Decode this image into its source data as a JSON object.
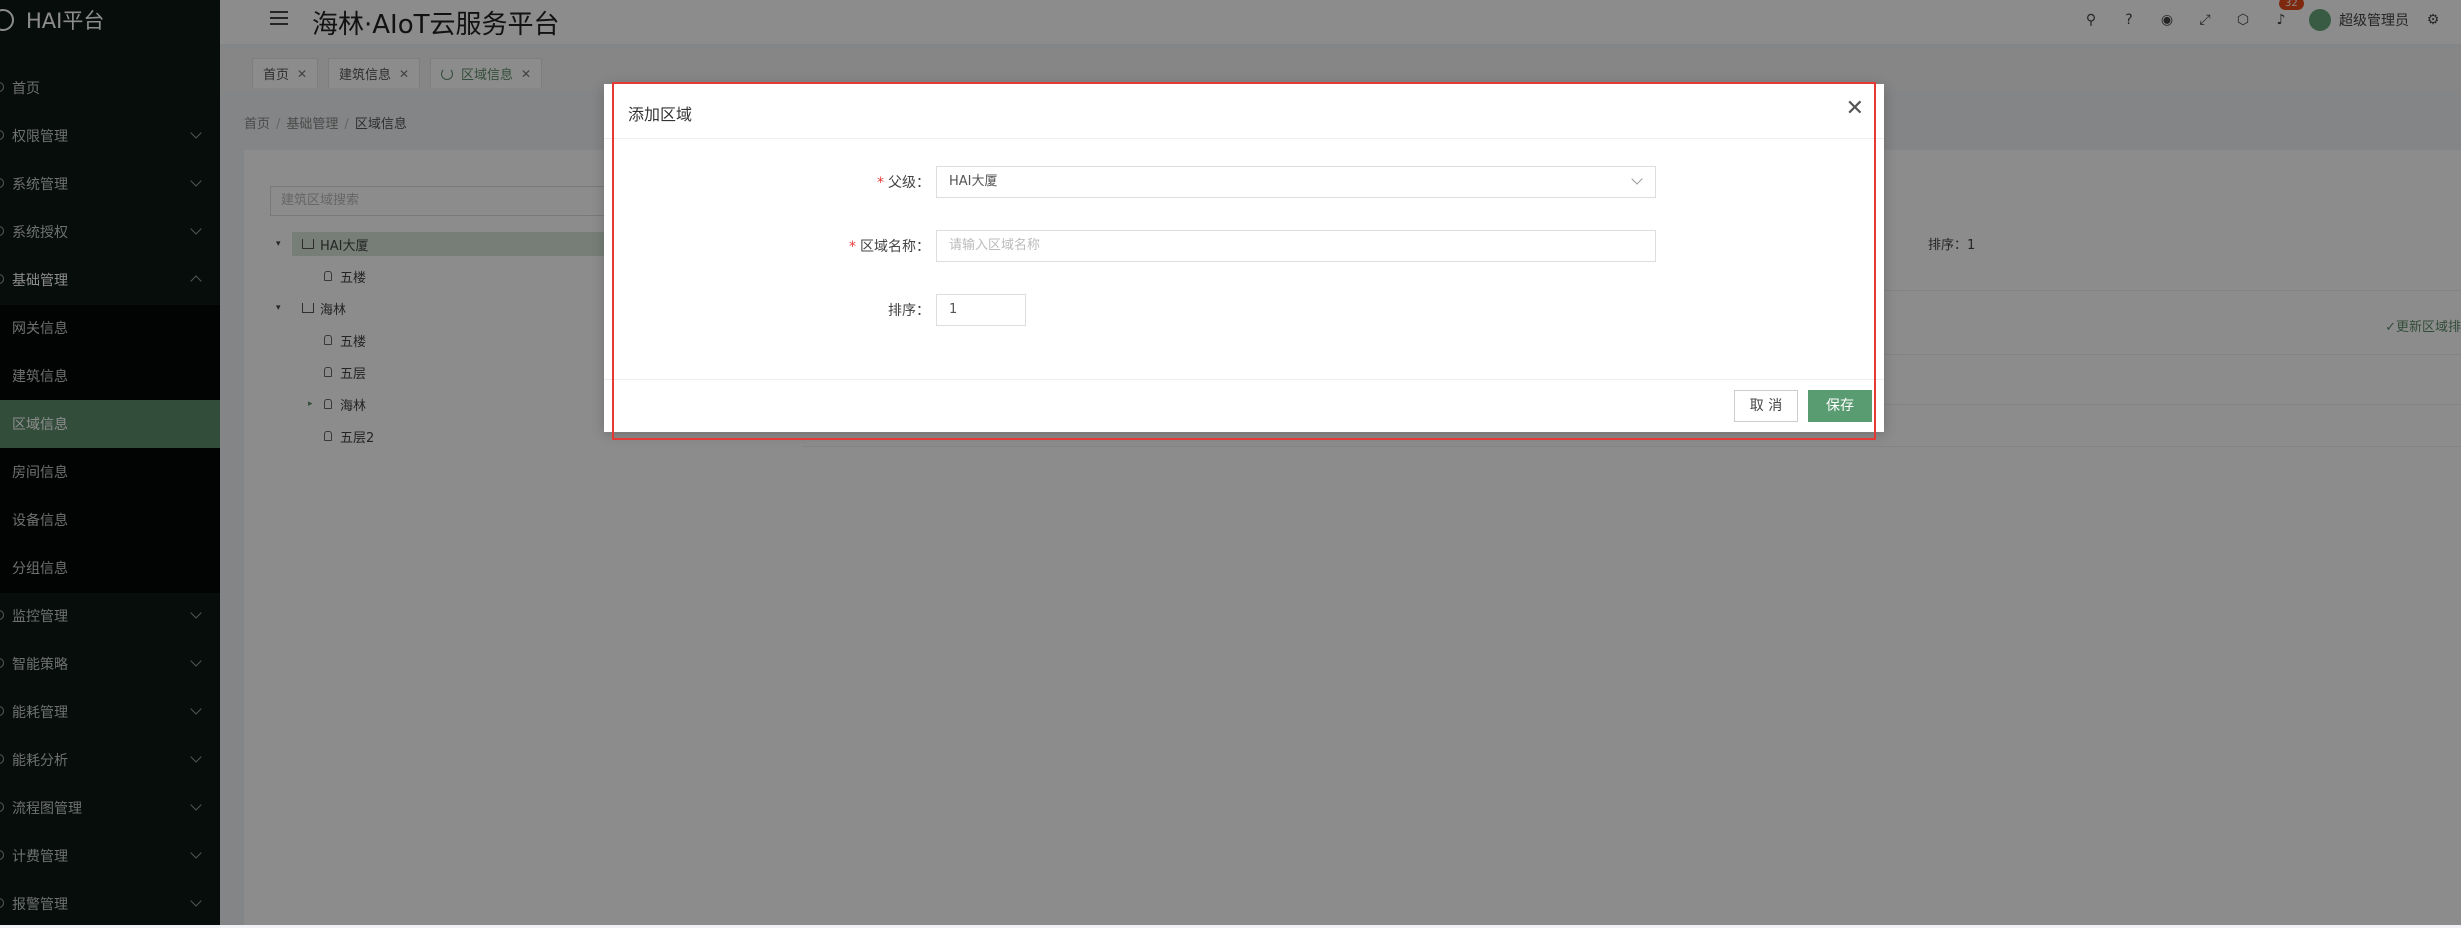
{
  "sidebar": {
    "brand": "HAI平台",
    "items": [
      {
        "label": "首页"
      },
      {
        "label": "权限管理"
      },
      {
        "label": "系统管理"
      },
      {
        "label": "系统授权"
      },
      {
        "label": "基础管理"
      },
      {
        "label": "网关信息"
      },
      {
        "label": "建筑信息"
      },
      {
        "label": "区域信息"
      },
      {
        "label": "房间信息"
      },
      {
        "label": "设备信息"
      },
      {
        "label": "分组信息"
      },
      {
        "label": "监控管理"
      },
      {
        "label": "智能策略"
      },
      {
        "label": "能耗管理"
      },
      {
        "label": "能耗分析"
      },
      {
        "label": "流程图管理"
      },
      {
        "label": "计费管理"
      },
      {
        "label": "报警管理"
      }
    ]
  },
  "header": {
    "title": "海林·AIoT云服务平台",
    "notification_count": "32",
    "username": "超级管理员"
  },
  "tabs": [
    {
      "label": "首页"
    },
    {
      "label": "建筑信息"
    },
    {
      "label": "区域信息"
    }
  ],
  "breadcrumb": [
    "首页",
    "基础管理",
    "区域信息"
  ],
  "tree": {
    "search_placeholder": "建筑区域搜索",
    "nodes": [
      {
        "label": "HAI大厦"
      },
      {
        "label": "五楼"
      },
      {
        "label": "海林"
      },
      {
        "label": "五楼"
      },
      {
        "label": "五层"
      },
      {
        "label": "海林"
      },
      {
        "label": "五层2"
      }
    ]
  },
  "detail": {
    "sort_text": "排序：1",
    "update_link": "✓更新区域排"
  },
  "dialog": {
    "title": "添加区域",
    "fields": {
      "parent_label": "父级",
      "parent_value": "HAI大厦",
      "name_label": "区域名称",
      "name_placeholder": "请输入区域名称",
      "sort_label": "排序",
      "sort_value": "1"
    },
    "cancel_label": "取 消",
    "save_label": "保存"
  },
  "colors": {
    "accent": "#5e8d6c",
    "sidebar_bg": "#0e1915",
    "highlight_border": "#e53935"
  }
}
